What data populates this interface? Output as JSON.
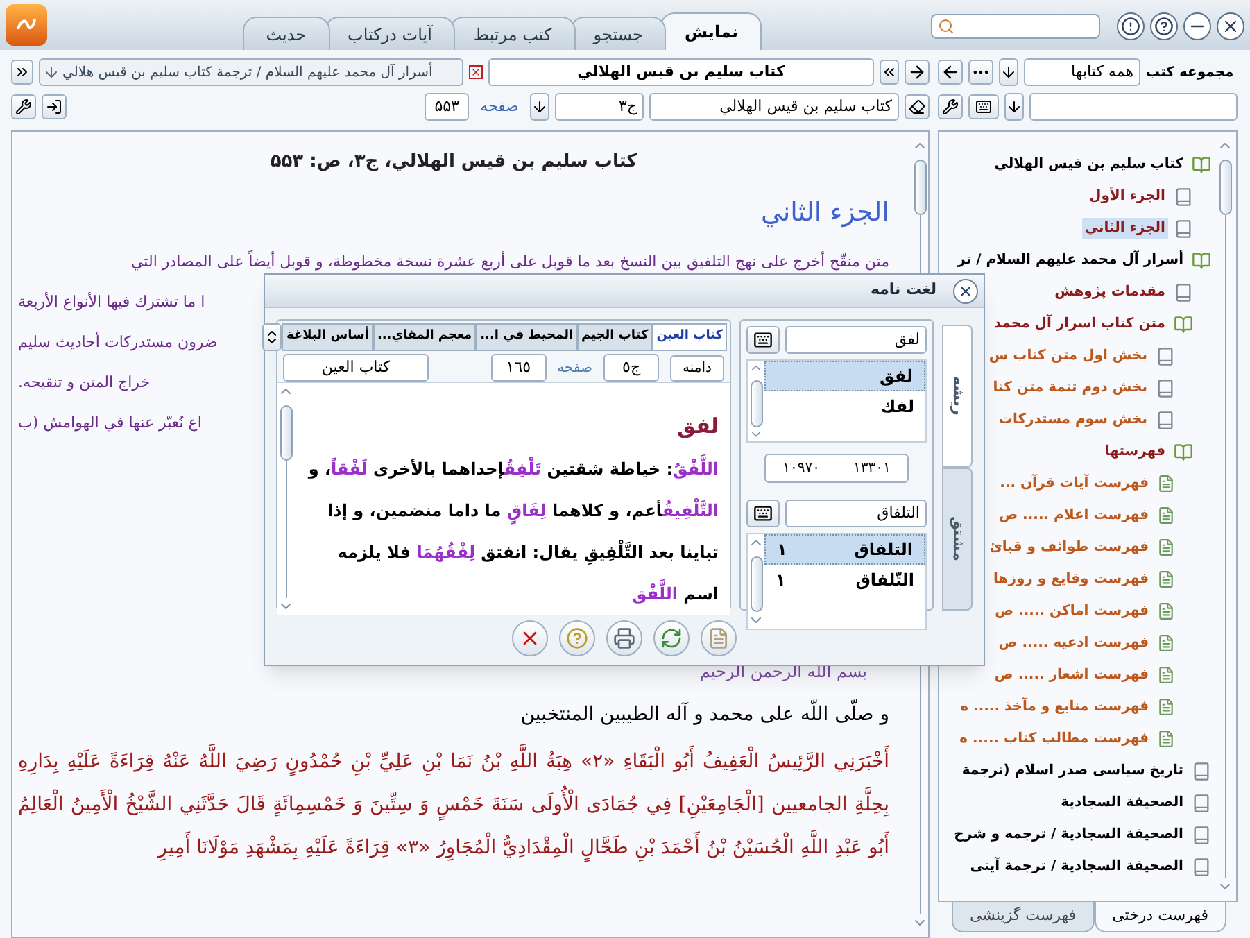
{
  "top_tabs": [
    {
      "label": "نمایش",
      "selected": true
    },
    {
      "label": "جستجو",
      "selected": false
    },
    {
      "label": "کتب مرتبط",
      "selected": false
    },
    {
      "label": "آيات درکتاب",
      "selected": false
    },
    {
      "label": "حديث",
      "selected": false
    }
  ],
  "viewer": {
    "open_book_tab": "کتاب سليم بن قيس الهلالي",
    "path_field": "أسرار آل محمد عليهم السلام / ترجمة کتاب سليم بن قيس هلالي",
    "book_field": "کتاب سليم بن قيس الهلالي",
    "volume_field": "ج۳",
    "page_label": "صفحه",
    "page_field": "۵۵۳",
    "page_header": "کتاب سليم بن قيس الهلالي، ج۳، ص: ۵۵۳",
    "heading": "الجزء الثاني",
    "intro_lines": [
      {
        "kind": "full",
        "text": "متن منقّح أخرج على نهج التلفيق بين النسخ بعد ما قوبل على أربع عشرة نسخة مخطوطة، و قوبل أيضاً على المصادر التي"
      },
      {
        "kind": "fragment",
        "text": "ا ما تشترك فيها الأنواع الأربعة"
      },
      {
        "kind": "fragment",
        "text": "ضرون مستدركات أحاديث سليم"
      },
      {
        "kind": "fragment",
        "text": "خراج المتن و تنقيحه."
      },
      {
        "kind": "fragment",
        "text": "اع نُعبّر عنها في الهوامش (ب"
      }
    ],
    "basmala": "بسم الله الرحمن الرحيم",
    "salutation": "و صلّى اللّه على محمد و آله الطيبين المنتخبين",
    "narration": "أَخْبَرَنِي الرَّئِيسُ الْعَفِيفُ أَبُو الْبَقَاءِ «٢» هِبَةُ اللَّهِ بْنُ نَمَا بْنِ عَلِيِّ بْنِ حُمْدُونٍ رَضِيَ اللَّهُ عَنْهُ قِرَاءَةً عَلَيْهِ بِدَارِهِ بِحِلَّةِ الجامعيين [الْجَامِعَيْنِ] فِي جُمَادَى الْأُولَى سَنَةَ خَمْسٍ وَ سِتِّينَ وَ خَمْسِمِائَةٍ قَالَ حَدَّثَنِي الشَّيْخُ الْأَمِينُ الْعَالِمُ أَبُو عَبْدِ اللَّهِ الْحُسَيْنُ بْنُ أَحْمَدَ بْنِ طَحَّالٍ الْمِقْدَادِيُّ الْمُجَاوِرُ «٣» قِرَاءَةً عَلَيْهِ بِمَشْهَدِ مَوْلَانَا أَمِيرِ"
  },
  "library": {
    "label": "مجموعه کتب",
    "collection": "همه کتابها",
    "tree": [
      {
        "label": "کتاب سليم بن قيس الهلالي",
        "kind": "collection",
        "selected": false,
        "children": [
          {
            "label": "الجزء الأول",
            "kind": "book",
            "selected": false
          },
          {
            "label": "الجزء الثاني",
            "kind": "book",
            "selected": true
          }
        ]
      },
      {
        "label": "أسرار آل محمد عليهم السلام / تر",
        "kind": "collection",
        "selected": false,
        "children": [
          {
            "label": "مقدمات پژوهش",
            "kind": "book",
            "selected": false
          },
          {
            "label": "متن کتاب اسرار آل محمد",
            "kind": "collection",
            "selected": false,
            "children": [
              {
                "label": "بخش اول متن کتاب س",
                "kind": "book",
                "selected": false
              },
              {
                "label": "بخش دوم تتمة متن کتا",
                "kind": "book",
                "selected": false
              },
              {
                "label": "بخش سوم مستدرکات",
                "kind": "book",
                "selected": false
              }
            ]
          },
          {
            "label": "فهرستها",
            "kind": "collection",
            "selected": false,
            "children": [
              {
                "label": "فهرست آيات قرآن ...",
                "kind": "index",
                "selected": false
              },
              {
                "label": "فهرست اعلام ..... ص",
                "kind": "index",
                "selected": false
              },
              {
                "label": "فهرست طوائف و قبائ",
                "kind": "index",
                "selected": false
              },
              {
                "label": "فهرست وقايع و روزها",
                "kind": "index",
                "selected": false
              },
              {
                "label": "فهرست اماکن ..... ص",
                "kind": "index",
                "selected": false
              },
              {
                "label": "فهرست ادعيه ..... ص",
                "kind": "index",
                "selected": false
              },
              {
                "label": "فهرست اشعار ..... ص",
                "kind": "index",
                "selected": false
              },
              {
                "label": "فهرست منابع و مآخذ ..... ه",
                "kind": "index",
                "selected": false
              },
              {
                "label": "فهرست مطالب کتاب ..... ه",
                "kind": "index",
                "selected": false
              }
            ]
          }
        ]
      },
      {
        "label": "تاريخ سياسى صدر اسلام (ترجمة",
        "kind": "book",
        "selected": false
      },
      {
        "label": "الصحيفة السجادية",
        "kind": "book",
        "selected": false
      },
      {
        "label": "الصحيفة السجادية / ترجمه و شرح",
        "kind": "book",
        "selected": false
      },
      {
        "label": "الصحيفة السجادية / ترجمة آيتى",
        "kind": "book",
        "selected": false
      }
    ],
    "tabs": [
      {
        "label": "فهرست درختی",
        "selected": true
      },
      {
        "label": "فهرست گزينشی",
        "selected": false
      }
    ]
  },
  "dictionary": {
    "title": "لغت نامه",
    "books": [
      {
        "label": "کتاب العين",
        "selected": true
      },
      {
        "label": "کتاب الجيم",
        "selected": false
      },
      {
        "label": "المحيط في ا...",
        "selected": false
      },
      {
        "label": "معجم المقاي...",
        "selected": false
      },
      {
        "label": "أساس البلاغة",
        "selected": false
      }
    ],
    "scope_button": "دامنه",
    "volume_field": "ج٥",
    "page_label": "صفحه",
    "page_field": "١٦٥",
    "book_field": "کتاب العين",
    "entry": "لفق",
    "definition": [
      {
        "text": "اللَّفْقُ",
        "highlight": true
      },
      {
        "text": ": خياطة شقتين ",
        "highlight": false
      },
      {
        "text": "تَلْفِقُ",
        "highlight": true
      },
      {
        "text": "إحداهما بالأخرى ",
        "highlight": false
      },
      {
        "text": "لَفْقاً",
        "highlight": true
      },
      {
        "text": "، و ",
        "highlight": false
      },
      {
        "text": "التَّلْفِيقُ",
        "highlight": true
      },
      {
        "text": "أعم، و كلاهما ",
        "highlight": false
      },
      {
        "text": "لِفَاقٍ",
        "highlight": true
      },
      {
        "text": " ما داما منضمين، و إذا تباينا بعد التَّلْفِيقِ يقال: انفتق ",
        "highlight": false
      },
      {
        "text": "لِفْقُهُمَا",
        "highlight": true
      },
      {
        "text": " فلا يلزمه اسم ",
        "highlight": false
      },
      {
        "text": "اللَّفْق",
        "highlight": true
      }
    ],
    "side_tabs": [
      {
        "label": "ريشه",
        "selected": true
      },
      {
        "label": "مشتق",
        "selected": false
      }
    ],
    "root_query": "لفق",
    "roots": [
      {
        "label": "لفق",
        "selected": true
      },
      {
        "label": "لفك",
        "selected": false
      }
    ],
    "counts": [
      "١٣٣٠١",
      "١٠٩٧٠"
    ],
    "derived_query": "التلفاق",
    "derived": [
      {
        "label": "التلفاق",
        "count": "١",
        "selected": true
      },
      {
        "label": "التّلفاق",
        "count": "١",
        "selected": false
      }
    ]
  }
}
